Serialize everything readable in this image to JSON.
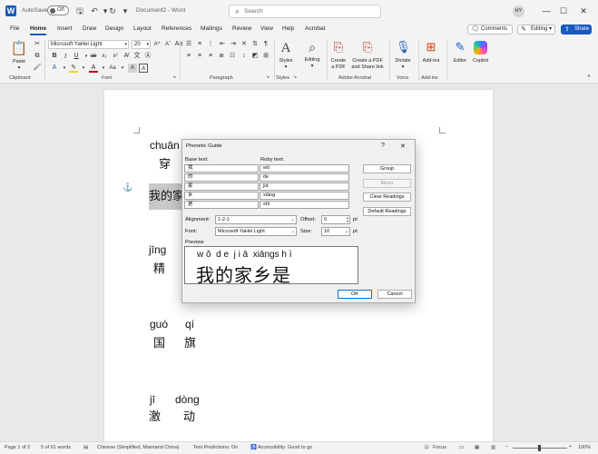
{
  "app": {
    "autosave_label": "AutoSave",
    "autosave_state": "Off",
    "doc_title": "Document2 - Word",
    "search_placeholder": "Search",
    "avatar_initials": "HY"
  },
  "menu": [
    "File",
    "Home",
    "Insert",
    "Draw",
    "Design",
    "Layout",
    "References",
    "Mailings",
    "Review",
    "View",
    "Help",
    "Acrobat"
  ],
  "top_buttons": {
    "comments": "Comments",
    "editing": "Editing",
    "share": "Share"
  },
  "ribbon": {
    "clipboard": {
      "paste": "Paste",
      "group": "Clipboard"
    },
    "font": {
      "name": "Microsoft YaHei Light",
      "size": "20",
      "group": "Font"
    },
    "paragraph": {
      "group": "Paragraph"
    },
    "styles": {
      "label": "Styles",
      "group": "Styles"
    },
    "editing": {
      "label": "Editing"
    },
    "acrobat": {
      "create_pdf": [
        "Create",
        "a PDF"
      ],
      "create_share": [
        "Create a PDF",
        "and Share link"
      ],
      "group": "Adobe Acrobat"
    },
    "voice": {
      "dictate": "Dictate",
      "group": "Voice"
    },
    "addins": {
      "label": "Add-ins",
      "group": "Add-ins"
    },
    "editor": "Editor",
    "copilot": "Copilot"
  },
  "document": {
    "lines": [
      {
        "pinyin": "chuān",
        "hanzi": "穿"
      },
      {
        "text": "我的家"
      },
      {
        "pinyin": "jīng",
        "hanzi": "精"
      },
      {
        "pinyin": [
          "guó",
          "qí"
        ],
        "hanzi": [
          "国",
          "旗"
        ]
      },
      {
        "pinyin": [
          "jī",
          "dòng"
        ],
        "hanzi": [
          "激",
          "动"
        ]
      }
    ]
  },
  "dialog": {
    "title": "Phonetic Guide",
    "help": "?",
    "close": "✕",
    "base_label": "Base text:",
    "ruby_label": "Ruby text:",
    "rows": [
      {
        "base": "我",
        "ruby": "wǒ"
      },
      {
        "base": "的",
        "ruby": "de"
      },
      {
        "base": "家",
        "ruby": "jiā"
      },
      {
        "base": "乡",
        "ruby": "xiāng"
      },
      {
        "base": "是",
        "ruby": "shì"
      }
    ],
    "buttons": {
      "group": "Group",
      "mono": "Mono",
      "clear": "Clear Readings",
      "default": "Default Readings"
    },
    "alignment_label": "Alignment:",
    "alignment_value": "1-2-1",
    "offset_label": "Offset:",
    "offset_value": "0",
    "offset_unit": "pt",
    "font_label": "Font:",
    "font_value": "Microsoft YaHei Light",
    "size_label": "Size:",
    "size_value": "10",
    "size_unit": "pt",
    "preview_label": "Preview",
    "preview_ruby": "w ǒ  d e  j i ā  xiāngs h ì",
    "preview_base": "我的家乡是",
    "ok": "OK",
    "cancel": "Cancel"
  },
  "status": {
    "page": "Page 1 of 2",
    "words": "5 of 61 words",
    "language": "Chinese (Simplified, Mainland China)",
    "predictions": "Text Predictions: On",
    "accessibility": "Accessibility: Good to go",
    "focus": "Focus",
    "zoom": "100%"
  },
  "colors": {
    "accent": "#185abd",
    "selection": "#c8c8c8"
  }
}
